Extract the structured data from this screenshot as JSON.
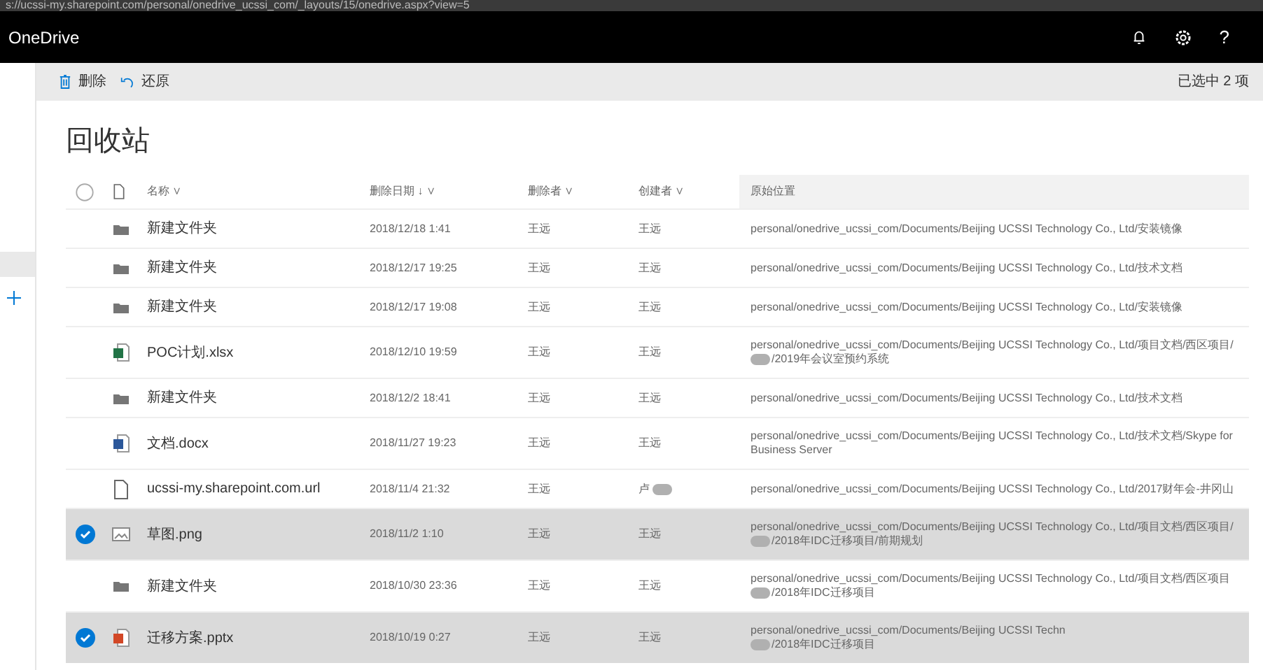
{
  "address_bar": {
    "url": "s://ucssi-my.sharepoint.com/personal/onedrive_ucssi_com/_layouts/15/onedrive.aspx?view=5"
  },
  "header": {
    "app_name": "OneDrive",
    "help": "?"
  },
  "command_bar": {
    "actions": [
      {
        "kind": "delete",
        "label": "删除"
      },
      {
        "kind": "restore",
        "label": "还原"
      }
    ],
    "selection": "已选中 2 项"
  },
  "page_title": "回收站",
  "table": {
    "columns": [
      {
        "label": "名称",
        "caret": "∨"
      },
      {
        "label": "删除日期",
        "sort_arrow": "↓",
        "caret": "∨"
      },
      {
        "label": "删除者",
        "caret": "∨"
      },
      {
        "label": "创建者",
        "caret": "∨"
      },
      {
        "label": "原始位置"
      }
    ],
    "rows": [
      {
        "kind": "folder",
        "selected": false,
        "name": "新建文件夹",
        "date": "2018/12/18 1:41",
        "deleter": "王远",
        "creator": "王远",
        "creator_redacted": false,
        "location": "personal/onedrive_ucssi_com/Documents/Beijing UCSSI Technology Co., Ltd/安装镜像"
      },
      {
        "kind": "folder",
        "selected": false,
        "name": "新建文件夹",
        "date": "2018/12/17 19:25",
        "deleter": "王远",
        "creator": "王远",
        "creator_redacted": false,
        "location": "personal/onedrive_ucssi_com/Documents/Beijing UCSSI Technology Co., Ltd/技术文档"
      },
      {
        "kind": "folder",
        "selected": false,
        "name": "新建文件夹",
        "date": "2018/12/17 19:08",
        "deleter": "王远",
        "creator": "王远",
        "creator_redacted": false,
        "location": "personal/onedrive_ucssi_com/Documents/Beijing UCSSI Technology Co., Ltd/安装镜像"
      },
      {
        "kind": "excel",
        "selected": false,
        "name": "POC计划.xlsx",
        "date": "2018/12/10 19:59",
        "deleter": "王远",
        "creator": "王远",
        "creator_redacted": false,
        "location": "personal/onedrive_ucssi_com/Documents/Beijing UCSSI Technology Co., Ltd/项目文档/西区项目/",
        "location_line2": "/2019年会议室预约系统",
        "redacted": true
      },
      {
        "kind": "folder",
        "selected": false,
        "name": "新建文件夹",
        "date": "2018/12/2 18:41",
        "deleter": "王远",
        "creator": "王远",
        "creator_redacted": false,
        "location": "personal/onedrive_ucssi_com/Documents/Beijing UCSSI Technology Co., Ltd/技术文档"
      },
      {
        "kind": "word",
        "selected": false,
        "name": "文档.docx",
        "date": "2018/11/27 19:23",
        "deleter": "王远",
        "creator": "王远",
        "creator_redacted": false,
        "location": "personal/onedrive_ucssi_com/Documents/Beijing UCSSI Technology Co., Ltd/技术文档/Skype for",
        "location_line2": "Business Server",
        "redacted": false
      },
      {
        "kind": "file",
        "selected": false,
        "name": "ucssi-my.sharepoint.com.url",
        "date": "2018/11/4 21:32",
        "deleter": "王远",
        "creator": "卢",
        "creator_redacted": true,
        "location": "personal/onedrive_ucssi_com/Documents/Beijing UCSSI Technology Co., Ltd/2017财年会-井冈山"
      },
      {
        "kind": "image",
        "selected": true,
        "name": "草图.png",
        "date": "2018/11/2 1:10",
        "deleter": "王远",
        "creator": "王远",
        "creator_redacted": false,
        "location": "personal/onedrive_ucssi_com/Documents/Beijing UCSSI Technology Co., Ltd/项目文档/西区项目/",
        "location_line2": "/2018年IDC迁移项目/前期规划",
        "redacted": true
      },
      {
        "kind": "folder",
        "selected": false,
        "name": "新建文件夹",
        "date": "2018/10/30 23:36",
        "deleter": "王远",
        "creator": "王远",
        "creator_redacted": false,
        "location": "personal/onedrive_ucssi_com/Documents/Beijing UCSSI Technology Co., Ltd/项目文档/西区项目",
        "location_line2": "/2018年IDC迁移项目",
        "redacted": true
      },
      {
        "kind": "powerpoint",
        "selected": true,
        "name": "迁移方案.pptx",
        "date": "2018/10/19 0:27",
        "deleter": "王远",
        "creator": "王远",
        "creator_redacted": false,
        "location": "personal/onedrive_ucssi_com/Documents/Beijing UCSSI Techn",
        "location_line2": "/2018年IDC迁移项目",
        "redacted": true
      }
    ]
  }
}
